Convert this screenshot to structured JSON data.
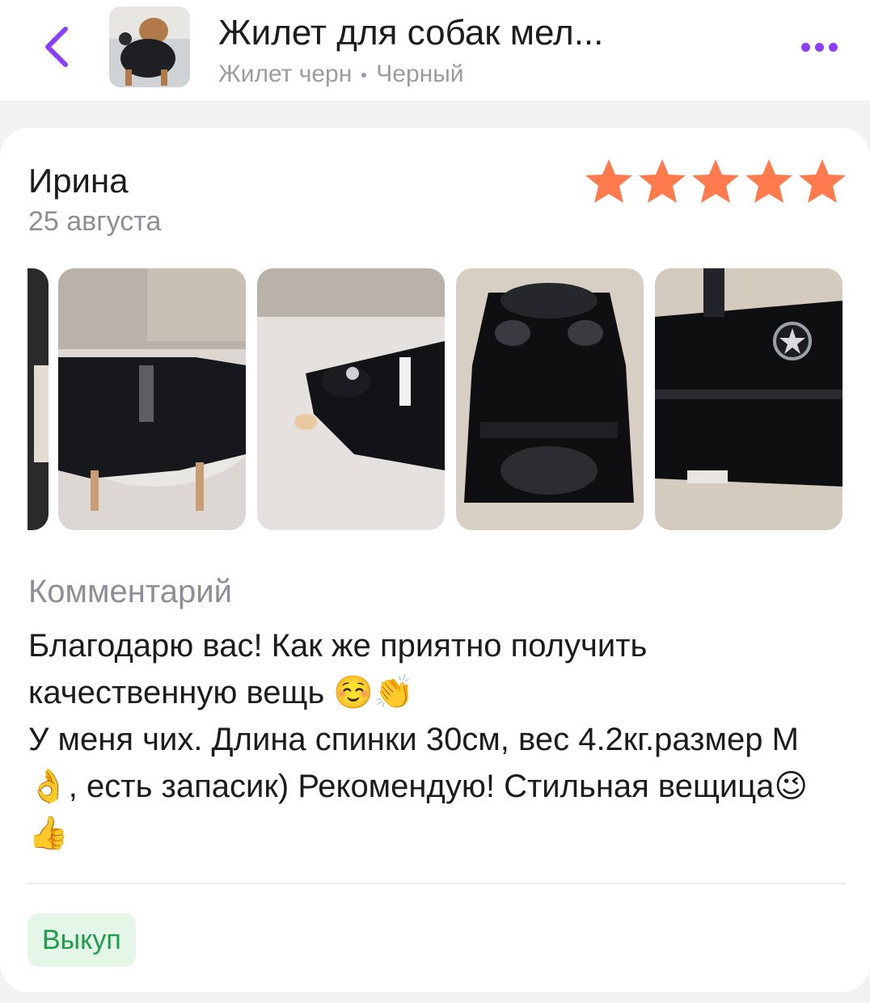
{
  "header": {
    "title": "Жилет для собак мел...",
    "variant_name": "Жилет черн",
    "variant_color": "Черный",
    "back_icon": "chevron-left-icon",
    "more_icon": "more-dots-icon",
    "accent_color": "#8b3ffc"
  },
  "review": {
    "author": "Ирина",
    "date": "25 августа",
    "rating": 5,
    "rating_max": 5,
    "star_color": "#ff7a4d",
    "comment_label": "Комментарий",
    "comment_text": "Благодарю вас! Как же приятно получить качественную вещь ☺️👏\nУ меня чих. Длина спинки 30см, вес 4.2кг.размер М👌, есть запасик) Рекомендую! Стильная вещица😉👍",
    "badge": "Выкуп",
    "badge_color": "#1f9d4c"
  }
}
